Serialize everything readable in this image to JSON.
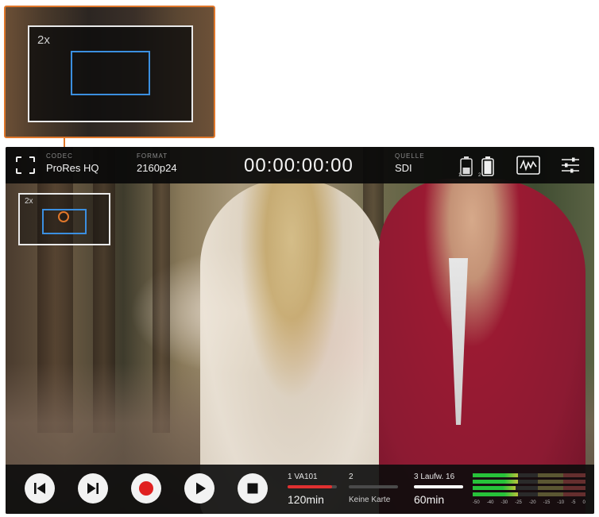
{
  "callout": {
    "zoom_label": "2x"
  },
  "topbar": {
    "codec_label": "CODEC",
    "codec_value": "ProRes HQ",
    "format_label": "FORMAT",
    "format_value": "2160p24",
    "timecode": "00:00:00:00",
    "source_label": "QUELLE",
    "source_value": "SDI",
    "battery_1_label": "1",
    "battery_2_label": "2"
  },
  "zoom_indicator": {
    "zoom_label": "2x"
  },
  "transport": {
    "buttons": [
      "skip-back",
      "skip-forward",
      "record",
      "play",
      "stop"
    ]
  },
  "slots": [
    {
      "name": "1 VA101",
      "value": "120min",
      "fill": 0.9,
      "fill_color": "#e03030"
    },
    {
      "name": "2",
      "value": "Keine Karte",
      "fill": 0,
      "fill_color": "#999999"
    },
    {
      "name": "3 Laufw. 16",
      "value": "60min",
      "fill": 1.0,
      "fill_color": "#ffffff"
    }
  ],
  "audio_meters": {
    "channel_levels": [
      0.4,
      0.4,
      0.38,
      0.4
    ],
    "scale": [
      "-50",
      "-40",
      "-30",
      "-25",
      "-20",
      "-15",
      "-10",
      "-5",
      "0"
    ]
  },
  "colors": {
    "accent": "#e0772b",
    "roi": "#3b8fe0",
    "record": "#e02020"
  }
}
